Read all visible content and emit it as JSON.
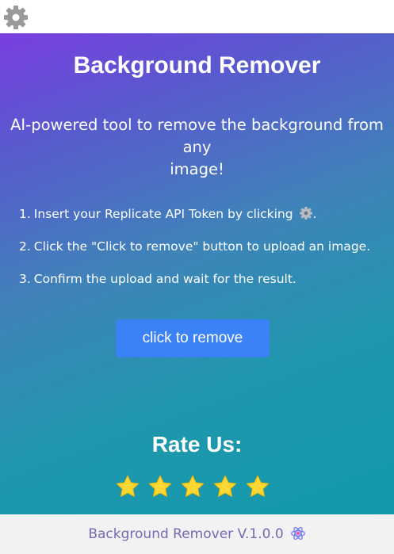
{
  "settings": {
    "icon": "gear-icon",
    "color": "#9a9a9a"
  },
  "main": {
    "title": "Background Remover",
    "subtitle_line1": "AI-powered tool to remove the background from any",
    "subtitle_line2": "image!",
    "steps": [
      {
        "num": "1.",
        "text": "Insert your Replicate API Token by clicking",
        "suffix": "."
      },
      {
        "num": "2.",
        "text": "Click the \"Click to remove\" button to upload an image."
      },
      {
        "num": "3.",
        "text": "Confirm the upload and wait for the result."
      }
    ],
    "cta_label": "click to remove",
    "rate_title": "Rate Us:",
    "rating_stars": 5,
    "star_color": "#fdd835"
  },
  "footer": {
    "text": "Background Remover V.1.0.0",
    "icon": "atom-icon"
  },
  "colors": {
    "gradient_start": "#7a3ee0",
    "gradient_end": "#1398ab",
    "button": "#3b82f6",
    "footer_bg": "#f2f2f2",
    "footer_text": "#7369b5"
  }
}
